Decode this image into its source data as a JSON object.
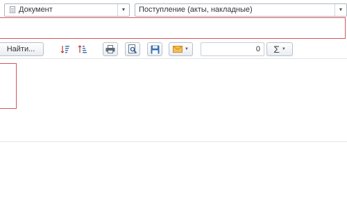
{
  "filters": {
    "type_combo": {
      "value": "Документ"
    },
    "kind_combo": {
      "value": "Поступление (акты, накладные)"
    }
  },
  "toolbar": {
    "find_label": "Найти...",
    "counter_value": "0",
    "sum_label": "Σ"
  },
  "icons": {
    "doc": "document-icon",
    "sort_desc": "sort-descending-icon",
    "sort_asc": "sort-ascending-icon",
    "print": "printer-icon",
    "preview": "print-preview-icon",
    "save": "floppy-disk-icon",
    "mail": "envelope-icon",
    "sum": "sum-icon"
  },
  "colors": {
    "highlight": "#d9535a",
    "mail_icon": "#e8a33a",
    "save_icon": "#3a6fb0"
  }
}
